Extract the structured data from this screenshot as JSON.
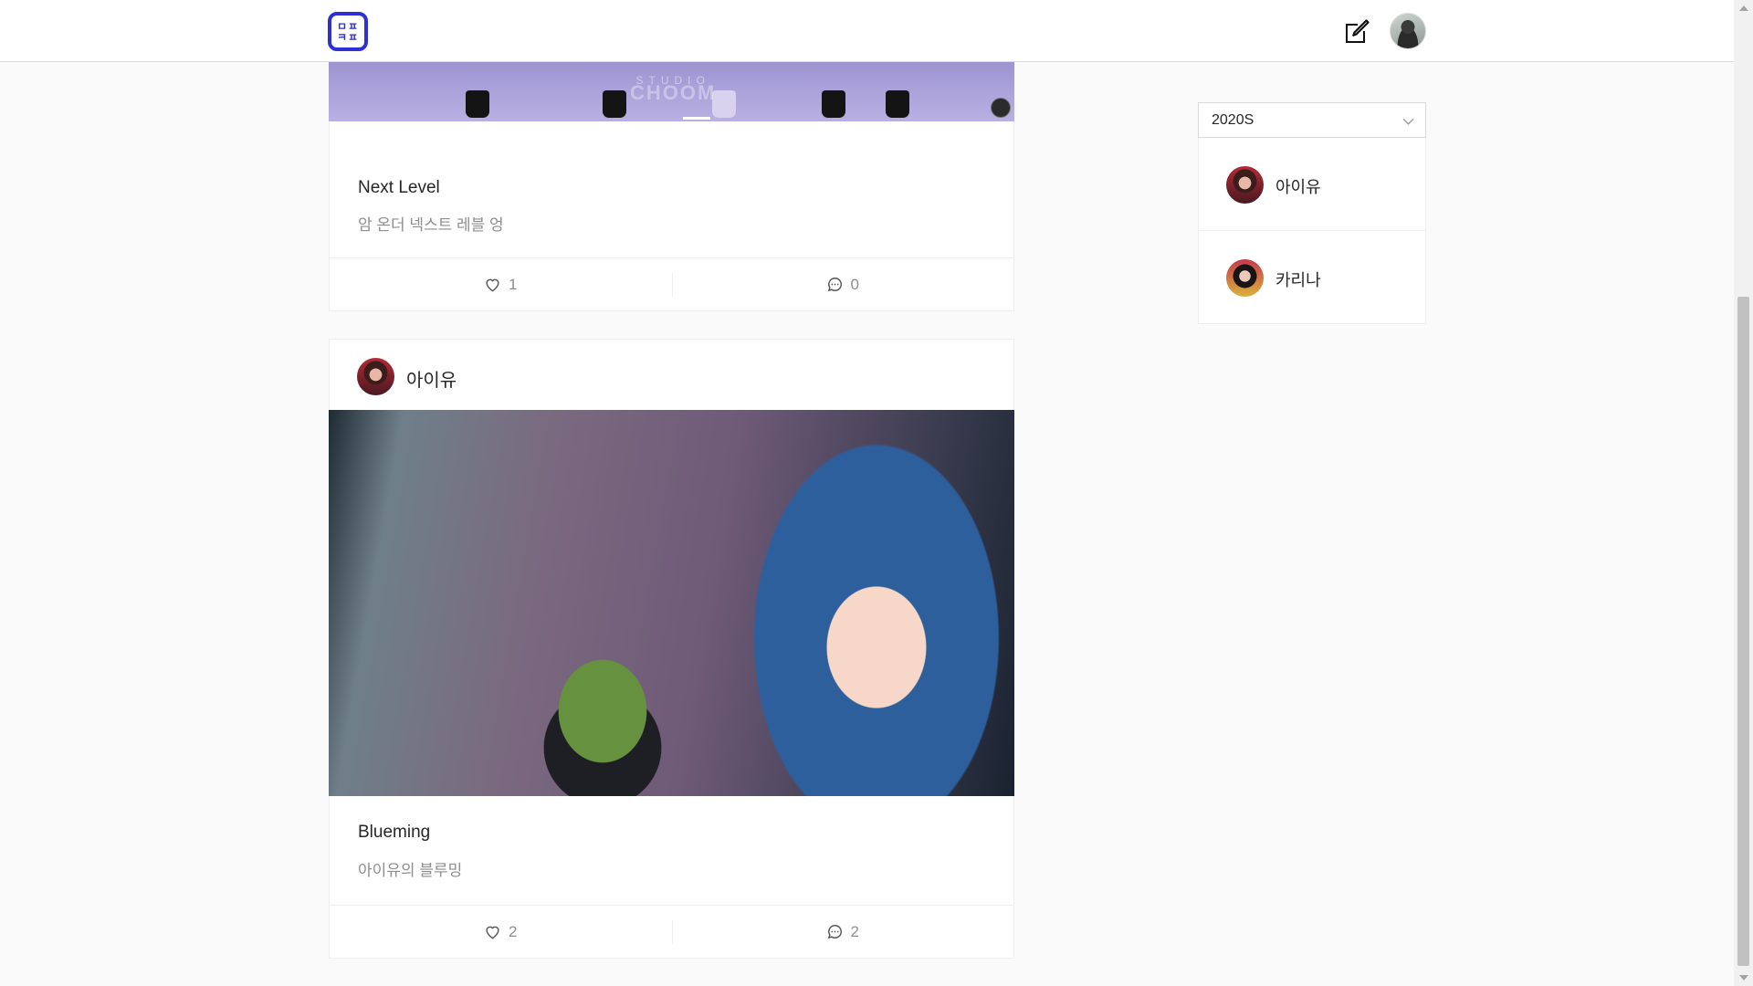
{
  "header": {
    "logo_text": "ㅁㅍ\nㅋㅍ",
    "logo_icon": "app-logo-icon",
    "edit_icon": "edit-icon",
    "avatar_icon": "avatar"
  },
  "feed": {
    "posts": [
      {
        "title": "Next Level",
        "description": "암 온더 넥스트 레블 엉",
        "image_overlay_top": "STUDIO",
        "image_overlay_bottom": "CHOOM",
        "badge_text": "CHOOM",
        "likes": "1",
        "comments": "0"
      },
      {
        "author": "아이유",
        "title": "Blueming",
        "description": "아이유의 블루밍",
        "likes": "2",
        "comments": "2"
      }
    ]
  },
  "sidebar": {
    "era_select": {
      "value": "2020S"
    },
    "artists": [
      {
        "name": "아이유"
      },
      {
        "name": "카리나"
      }
    ]
  },
  "colors": {
    "accent": "#2f2fd6",
    "text": "#262626",
    "muted": "#8e8e8e",
    "border": "#efefef",
    "background": "#fafafa"
  }
}
